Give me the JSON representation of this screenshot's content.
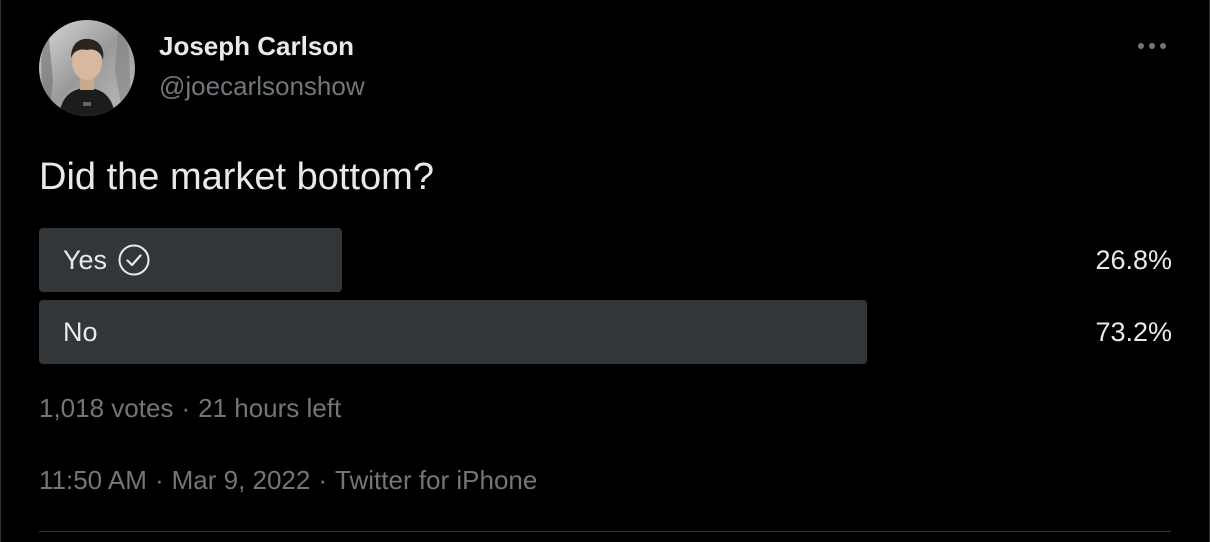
{
  "author": {
    "name": "Joseph Carlson",
    "handle": "@joecarlsonshow"
  },
  "menu_icon": "more-horizontal-icon",
  "tweet": {
    "text": "Did the market bottom?"
  },
  "poll": {
    "options": [
      {
        "label": "Yes",
        "percent_text": "26.8%",
        "percent": 26.8,
        "selected_icon": "check-circle-icon"
      },
      {
        "label": "No",
        "percent_text": "73.2%",
        "percent": 73.2
      }
    ],
    "votes": "1,018 votes",
    "time_left": "21 hours left"
  },
  "meta": {
    "time": "11:50 AM",
    "date": "Mar 9, 2022",
    "source": "Twitter for iPhone",
    "separator": "·"
  },
  "colors": {
    "background": "#000000",
    "text_primary": "#e7e9ea",
    "text_secondary": "#71767b",
    "poll_bar": "#333639",
    "border": "#2f3336"
  }
}
